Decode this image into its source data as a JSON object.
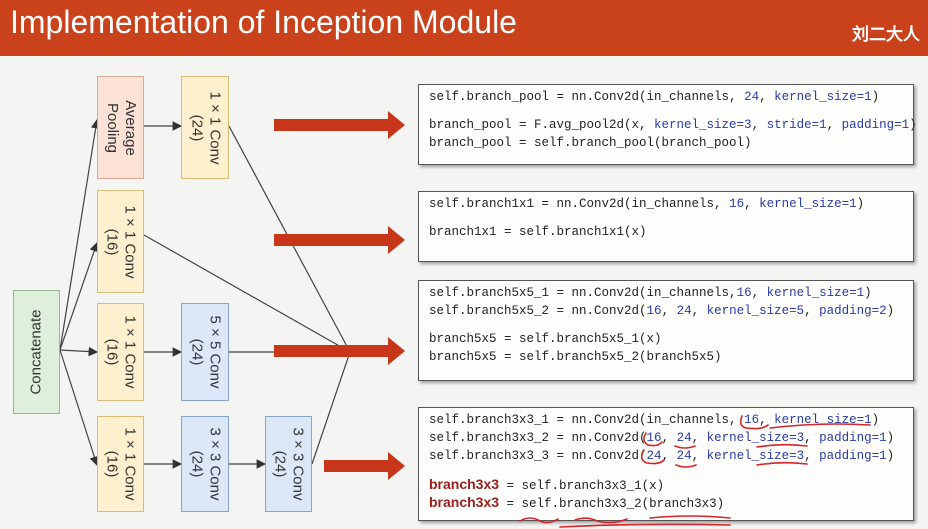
{
  "header": {
    "title": "Implementation of Inception Module",
    "author": "刘二大人"
  },
  "diagram": {
    "pool_block": {
      "line1": "Average",
      "line2": "Pooling"
    },
    "conv1x1_24": {
      "line1": "1 × 1 Conv",
      "line2": "(24)"
    },
    "conv1x1_16": {
      "line1": "1 × 1 Conv",
      "line2": "(16)"
    },
    "conv5x5_24": {
      "line1": "5 × 5 Conv",
      "line2": "(24)"
    },
    "conv3x3_24": {
      "line1": "3 × 3 Conv",
      "line2": "(24)"
    },
    "concat": {
      "label": "Concatenate"
    }
  },
  "code_pool": {
    "l1": "self.branch_pool = nn.Conv2d(in_channels, ",
    "l1_v": "24",
    "l1_s": ", ",
    "l1_k": "kernel_size=1",
    "l1_e": ")",
    "l2": "branch_pool = F.avg_pool2d(x, ",
    "l2_a": "kernel_size=3",
    "l2_b": ", ",
    "l2_c": "stride=1",
    "l2_d": ", ",
    "l2_e": "padding=1",
    "l2_f": ")",
    "l3": "branch_pool = self.branch_pool(branch_pool)"
  },
  "code_1x1": {
    "l1": "self.branch1x1 = nn.Conv2d(in_channels, ",
    "l1_v": "16",
    "l1_s": ", ",
    "l1_k": "kernel_size=1",
    "l1_e": ")",
    "l2": "branch1x1 = self.branch1x1(x)"
  },
  "code_5x5": {
    "l1": "self.branch5x5_1 = nn.Conv2d(in_channels,",
    "l1_v": "16",
    "l1_s": ", ",
    "l1_k": "kernel_size=1",
    "l1_e": ")",
    "l2": "self.branch5x5_2 = nn.Conv2d(",
    "l2_a": "16",
    "l2_b": ", ",
    "l2_c": "24",
    "l2_d": ", ",
    "l2_e": "kernel_size=5",
    "l2_f": ", ",
    "l2_g": "padding=2",
    "l2_h": ")",
    "l3": "branch5x5 = self.branch5x5_1(x)",
    "l4": "branch5x5 = self.branch5x5_2(branch5x5)"
  },
  "code_3x3": {
    "l1": "self.branch3x3_1 = nn.Conv2d(in_channels, ",
    "l1_v": "16",
    "l1_s": ", ",
    "l1_k": "kernel_size=1",
    "l1_e": ")",
    "l2": "self.branch3x3_2 = nn.Conv2d(",
    "l2_a": "16",
    "l2_b": ", ",
    "l2_c": "24",
    "l2_d": ", ",
    "l2_e": "kernel_size=3",
    "l2_f": ", ",
    "l2_g": "padding=1",
    "l2_h": ")",
    "l3": "self.branch3x3_3 = nn.Conv2d(",
    "l3_a": "24",
    "l3_b": ", ",
    "l3_c": "24",
    "l3_d": ", ",
    "l3_e": "kernel_size=3",
    "l3_f": ", ",
    "l3_g": "padding=1",
    "l3_h": ")",
    "l4_a": "branch3x3",
    "l4_b": " = self.branch3x3_1(x)",
    "l5_a": "branch3x3",
    "l5_b": " = self.branch3x3_2(branch3x3)"
  },
  "colors": {
    "header": "#c9421c",
    "arrow": "#c8361a",
    "keyword": "#2a3aa8",
    "annotation": "#d8232a"
  }
}
